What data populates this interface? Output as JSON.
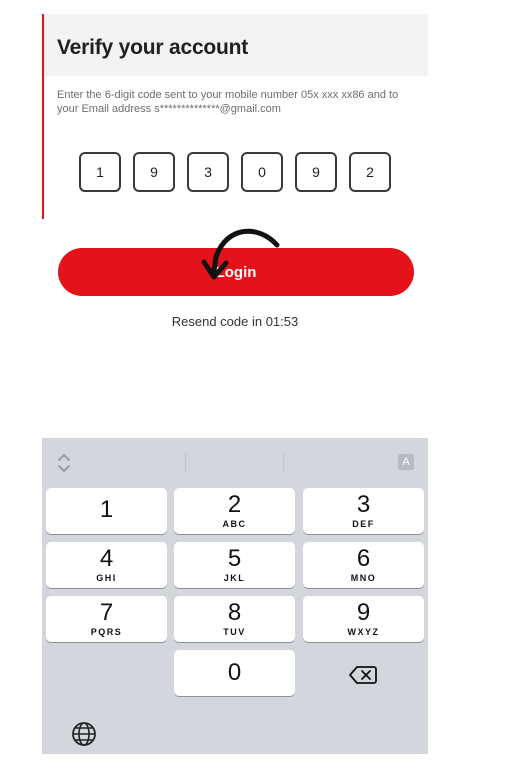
{
  "screen": {
    "title": "Verify your account",
    "description": "Enter the 6-digit code sent to your mobile number 05x xxx xx86 and to your Email address s**************@gmail.com",
    "otp_digits": [
      "1",
      "9",
      "3",
      "0",
      "9",
      "2"
    ],
    "login_label": "Login",
    "resend_text": "Resend code in 01:53"
  },
  "keyboard": {
    "a_key": "A",
    "keys": [
      {
        "num": "1",
        "letters": ""
      },
      {
        "num": "2",
        "letters": "ABC"
      },
      {
        "num": "3",
        "letters": "DEF"
      },
      {
        "num": "4",
        "letters": "GHI"
      },
      {
        "num": "5",
        "letters": "JKL"
      },
      {
        "num": "6",
        "letters": "MNO"
      },
      {
        "num": "7",
        "letters": "PQRS"
      },
      {
        "num": "8",
        "letters": "TUV"
      },
      {
        "num": "9",
        "letters": "WXYZ"
      },
      {
        "num": "0",
        "letters": ""
      }
    ],
    "icons": [
      "chevron-updown-icon",
      "globe-icon",
      "backspace-icon"
    ]
  },
  "colors": {
    "accent": "#e4121b",
    "keyboard_bg": "#d4d6dd"
  }
}
